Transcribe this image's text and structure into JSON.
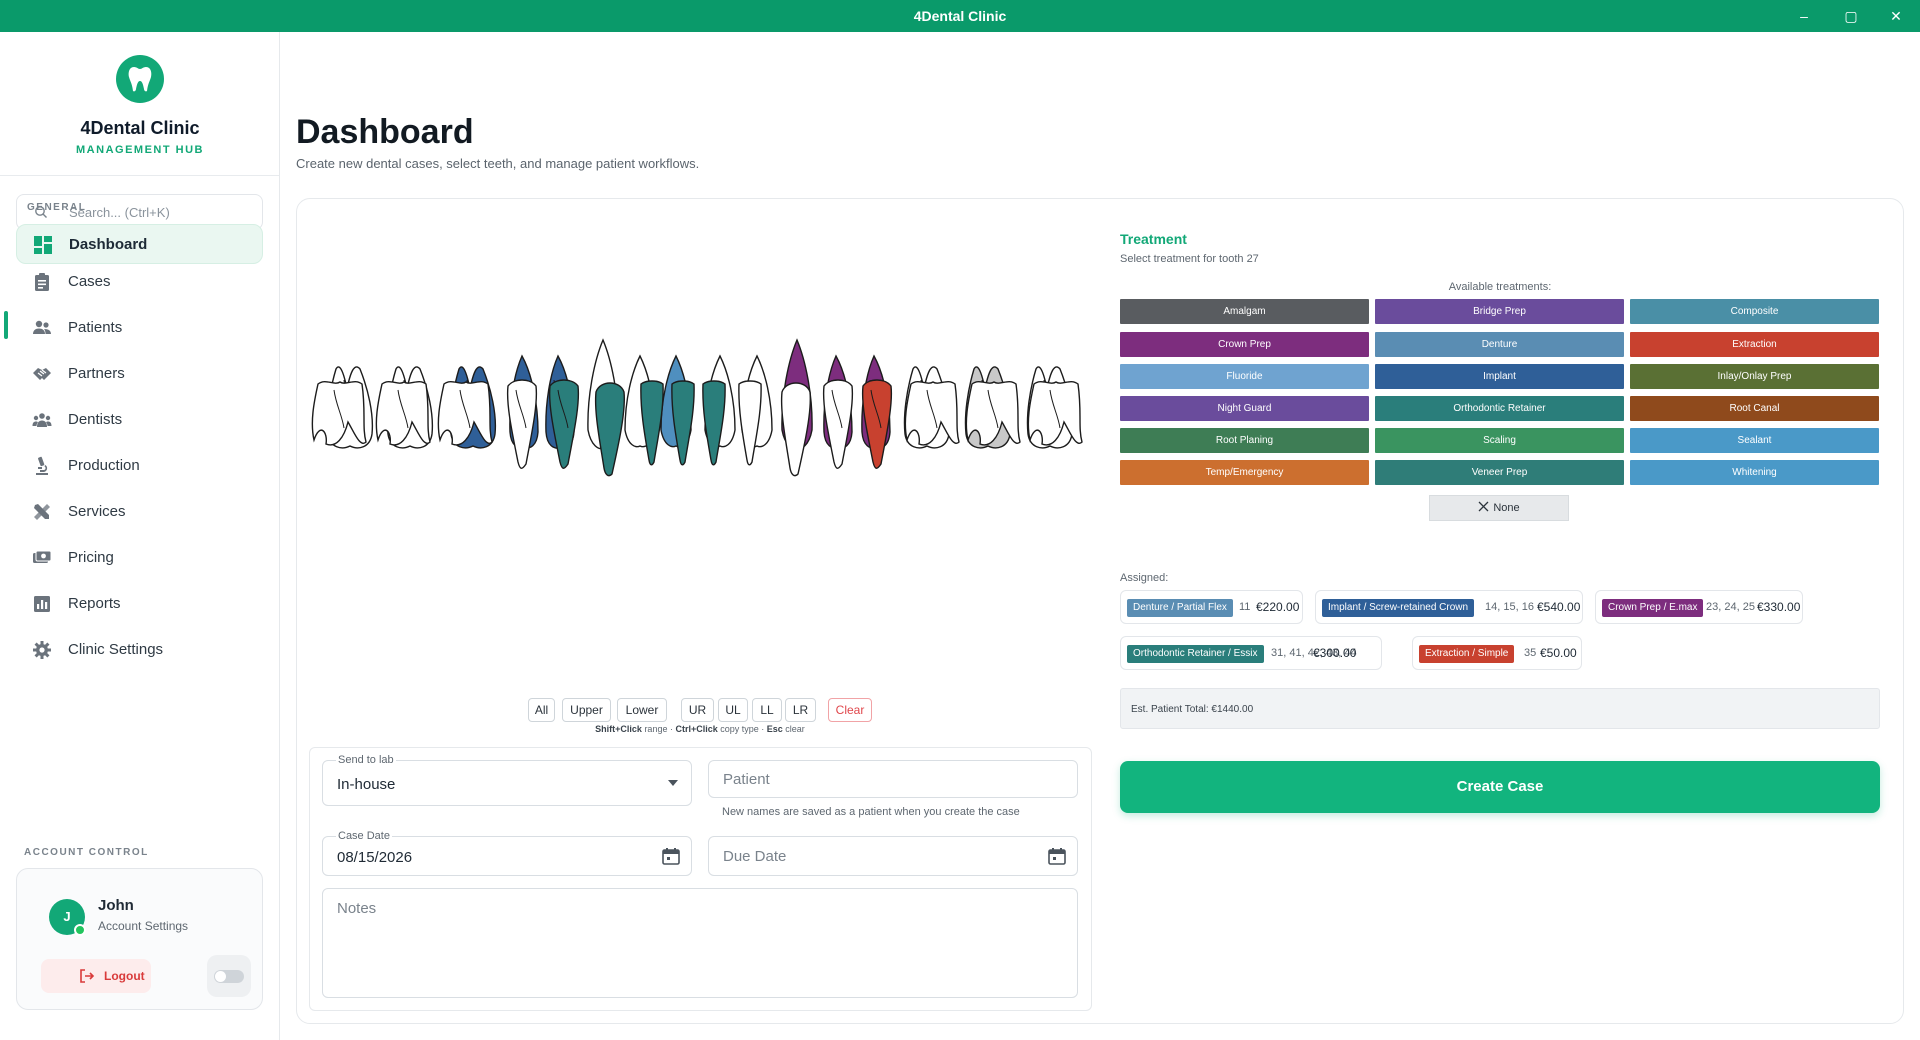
{
  "window": {
    "title": "4Dental Clinic"
  },
  "brand": {
    "name": "4Dental Clinic",
    "subtitle": "MANAGEMENT HUB"
  },
  "search": {
    "placeholder": "Search... (Ctrl+K)"
  },
  "sidebar": {
    "section_general": "GENERAL",
    "items": [
      {
        "label": "Dashboard",
        "icon": "dashboard-icon",
        "active": true
      },
      {
        "label": "Cases",
        "icon": "clipboard-icon"
      },
      {
        "label": "Patients",
        "icon": "users-icon"
      },
      {
        "label": "Partners",
        "icon": "handshake-icon"
      },
      {
        "label": "Dentists",
        "icon": "group-icon"
      },
      {
        "label": "Production",
        "icon": "microscope-icon"
      },
      {
        "label": "Services",
        "icon": "tools-icon"
      },
      {
        "label": "Pricing",
        "icon": "money-icon"
      },
      {
        "label": "Reports",
        "icon": "bar-chart-icon"
      },
      {
        "label": "Clinic Settings",
        "icon": "gear-icon"
      }
    ],
    "section_account": "ACCOUNT CONTROL",
    "account": {
      "initial": "J",
      "name": "John",
      "subtitle": "Account Settings",
      "logout_label": "Logout"
    }
  },
  "page": {
    "title": "Dashboard",
    "subtitle": "Create new dental cases, select teeth, and manage patient workflows."
  },
  "teeth_chart": {
    "upper": [
      {
        "fill": "none"
      },
      {
        "fill": "none"
      },
      {
        "fill": "#2f5f98"
      },
      {
        "fill": "#2f5f98"
      },
      {
        "fill": "#2f5f98"
      },
      {
        "fill": "none"
      },
      {
        "fill": "none"
      },
      {
        "fill": "#4f8fbf"
      },
      {
        "fill": "none"
      },
      {
        "fill": "none"
      },
      {
        "fill": "#7d2d7e"
      },
      {
        "fill": "#7d2d7e"
      },
      {
        "fill": "#7d2d7e"
      },
      {
        "fill": "none"
      },
      {
        "fill": "#c8c8c8"
      },
      {
        "fill": "none"
      }
    ],
    "lower": [
      {
        "fill": "none"
      },
      {
        "fill": "none"
      },
      {
        "fill": "none"
      },
      {
        "fill": "none"
      },
      {
        "fill": "#2a7e7b"
      },
      {
        "fill": "#2a7e7b"
      },
      {
        "fill": "#2a7e7b"
      },
      {
        "fill": "#2a7e7b"
      },
      {
        "fill": "#2a7e7b"
      },
      {
        "fill": "none"
      },
      {
        "fill": "none"
      },
      {
        "fill": "none"
      },
      {
        "fill": "#c8412f"
      },
      {
        "fill": "none"
      },
      {
        "fill": "none"
      },
      {
        "fill": "none"
      }
    ]
  },
  "quick_select": {
    "buttons": [
      "All",
      "Upper",
      "Lower",
      "UR",
      "UL",
      "LL",
      "LR"
    ],
    "clear": "Clear",
    "hint_shift": "Shift+Click",
    "hint_range": " range · ",
    "hint_ctrl": "Ctrl+Click",
    "hint_copy": " copy type · ",
    "hint_esc": "Esc",
    "hint_clear": " clear"
  },
  "form": {
    "lab_label": "Send to lab",
    "lab_value": "In-house",
    "patient_placeholder": "Patient",
    "patient_note": "New names are saved as a patient when you create the case",
    "case_date_label": "Case Date",
    "case_date_value": "08/15/2026",
    "due_date_placeholder": "Due Date",
    "notes_placeholder": "Notes"
  },
  "treatment": {
    "title": "Treatment",
    "subtitle": "Select treatment for tooth 27",
    "available_label": "Available treatments:",
    "options": [
      {
        "label": "Amalgam",
        "color": "#595c60"
      },
      {
        "label": "Bridge Prep",
        "color": "#6a4c9c"
      },
      {
        "label": "Composite",
        "color": "#4a8fa6"
      },
      {
        "label": "Crown Prep",
        "color": "#7d2d7e"
      },
      {
        "label": "Denture",
        "color": "#5a8db3"
      },
      {
        "label": "Extraction",
        "color": "#c8412f"
      },
      {
        "label": "Fluoride",
        "color": "#6fa3d0"
      },
      {
        "label": "Implant",
        "color": "#2f5f98"
      },
      {
        "label": "Inlay/Onlay Prep",
        "color": "#5a7034"
      },
      {
        "label": "Night Guard",
        "color": "#6a4c9c"
      },
      {
        "label": "Orthodontic Retainer",
        "color": "#2a7e7b"
      },
      {
        "label": "Root Canal",
        "color": "#8f4a1c"
      },
      {
        "label": "Root Planing",
        "color": "#3e7d55"
      },
      {
        "label": "Scaling",
        "color": "#3a9460"
      },
      {
        "label": "Sealant",
        "color": "#4a99c8"
      },
      {
        "label": "Temp/Emergency",
        "color": "#cc6f2f"
      },
      {
        "label": "Veneer Prep",
        "color": "#2f7d78"
      },
      {
        "label": "Whitening",
        "color": "#4a99c8"
      }
    ],
    "none_label": "None",
    "assigned_label": "Assigned:",
    "assigned": [
      {
        "tag": "Denture / Partial Flex",
        "color": "#5a8db3",
        "teeth": "11",
        "price": "€220.00"
      },
      {
        "tag": "Implant / Screw-retained Crown",
        "color": "#2f5f98",
        "teeth": "14, 15, 16",
        "price": "€540.00"
      },
      {
        "tag": "Crown Prep / E.max",
        "color": "#7d2d7e",
        "teeth": "23, 24, 25",
        "price": "€330.00"
      },
      {
        "tag": "Orthodontic Retainer / Essix",
        "color": "#2a7e7b",
        "teeth": "31, 41, 42, 43, 44",
        "price": "€300.00"
      },
      {
        "tag": "Extraction / Simple",
        "color": "#c8412f",
        "teeth": "35",
        "price": "€50.00"
      }
    ],
    "total": "Est. Patient Total: €1440.00",
    "create_label": "Create Case"
  }
}
